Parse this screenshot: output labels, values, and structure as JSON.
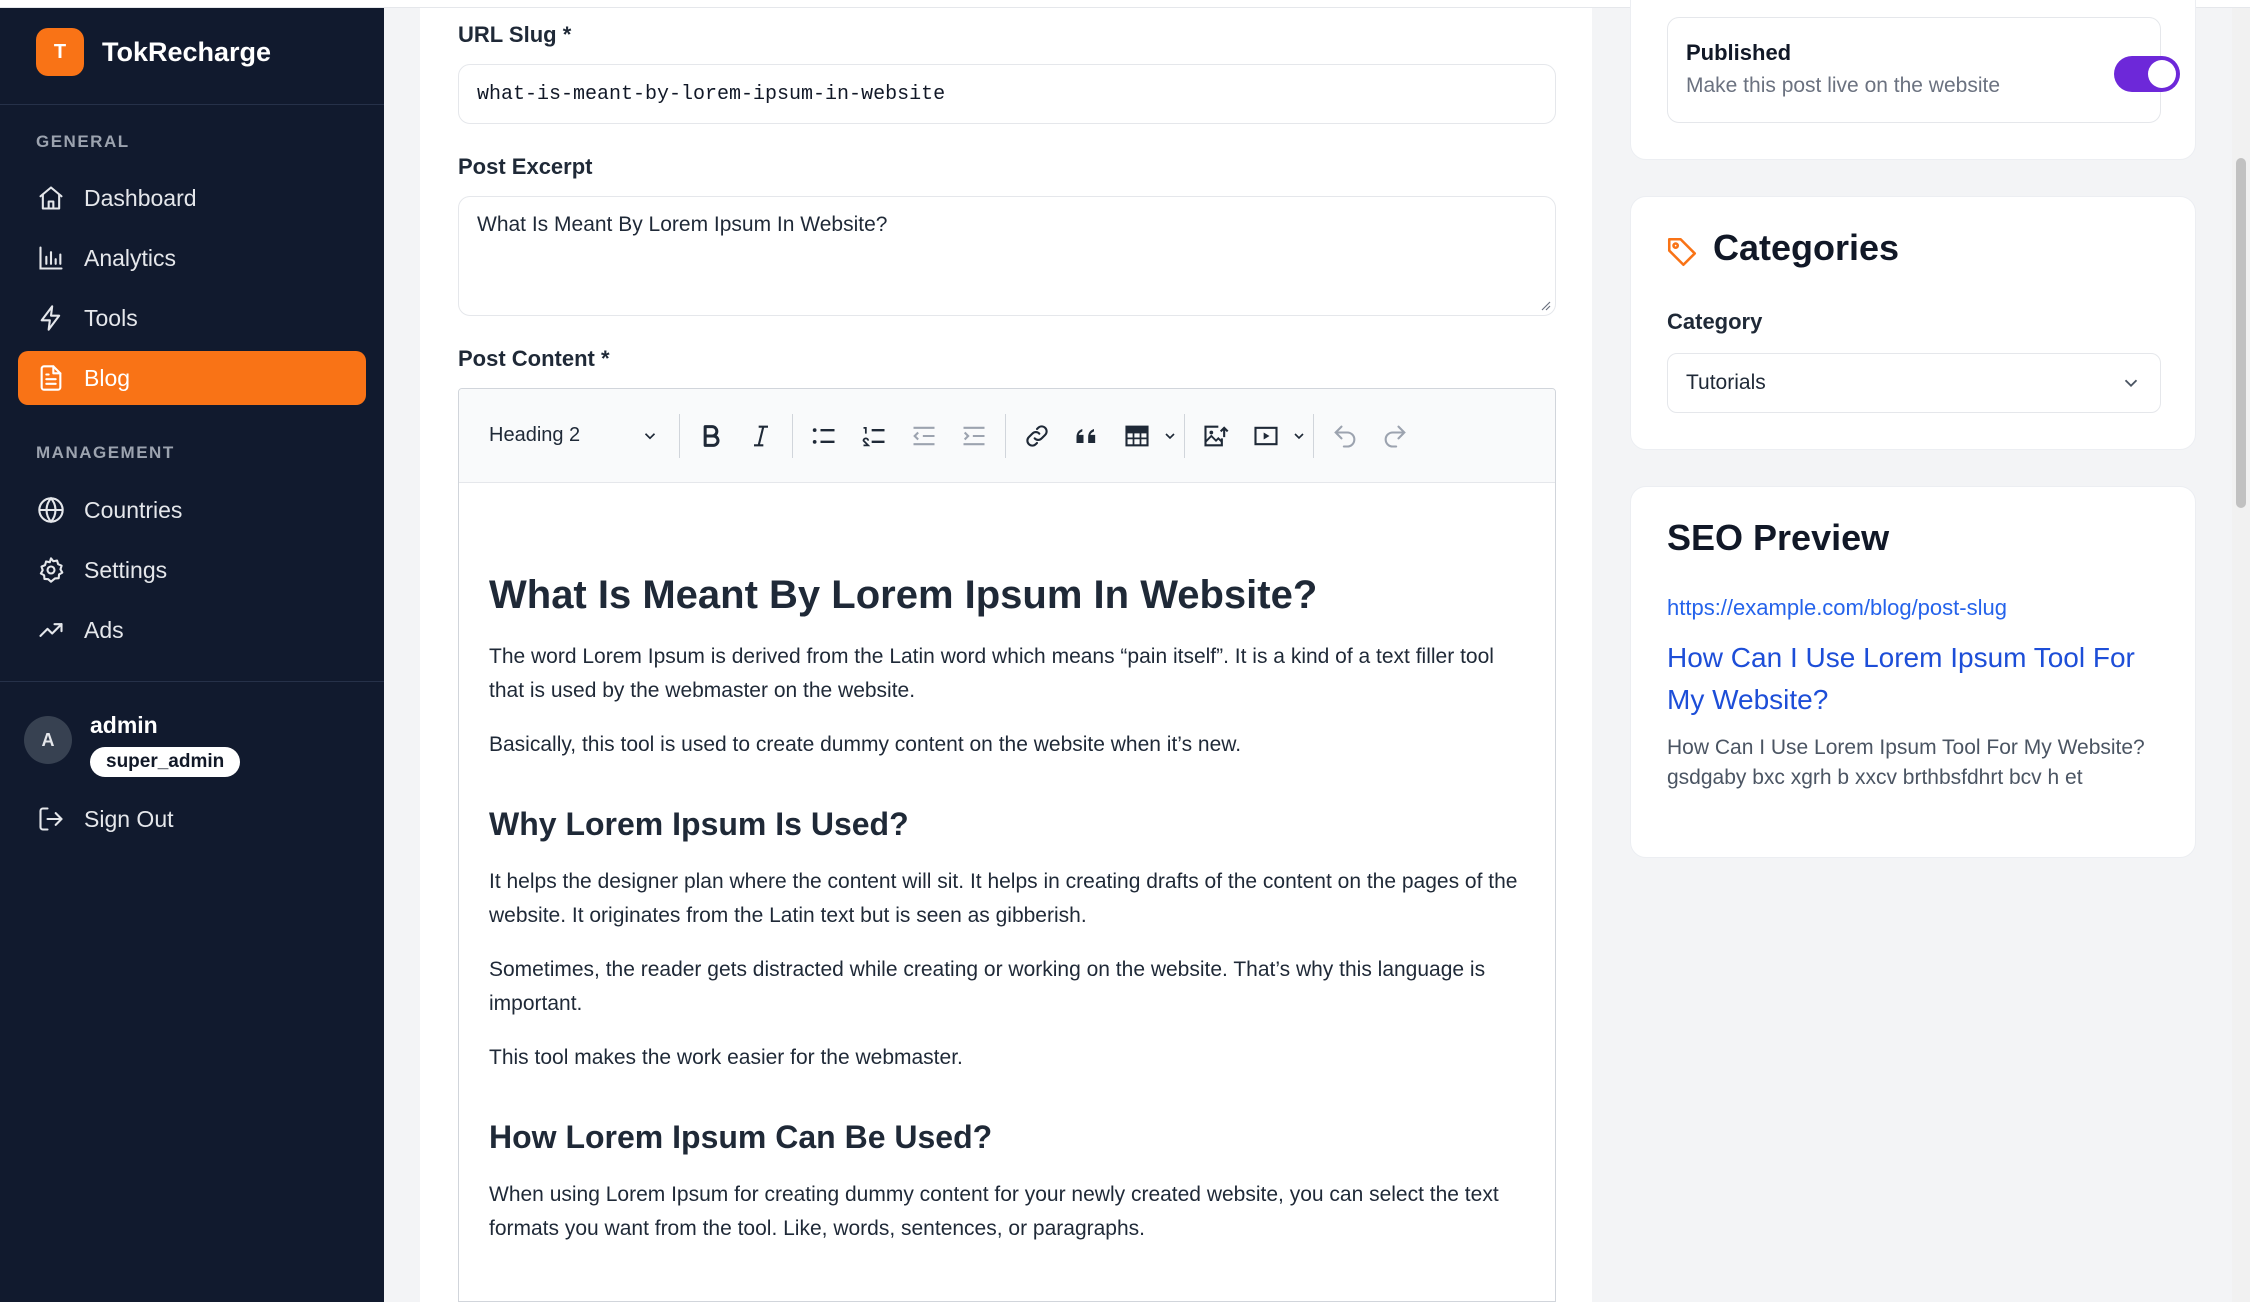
{
  "brand": {
    "logo_letter": "T",
    "name": "TokRecharge"
  },
  "sidebar": {
    "general_label": "GENERAL",
    "management_label": "MANAGEMENT",
    "items": [
      {
        "label": "Dashboard",
        "icon": "home-icon"
      },
      {
        "label": "Analytics",
        "icon": "bar-chart-icon"
      },
      {
        "label": "Tools",
        "icon": "bolt-icon"
      },
      {
        "label": "Blog",
        "icon": "document-icon",
        "active": true
      },
      {
        "label": "Countries",
        "icon": "globe-icon"
      },
      {
        "label": "Settings",
        "icon": "gear-icon"
      },
      {
        "label": "Ads",
        "icon": "trending-up-icon"
      }
    ],
    "user": {
      "avatar_letter": "A",
      "name": "admin",
      "role": "super_admin"
    },
    "sign_out": "Sign Out"
  },
  "form": {
    "slug_label": "URL Slug *",
    "slug_value": "what-is-meant-by-lorem-ipsum-in-website",
    "excerpt_label": "Post Excerpt",
    "excerpt_value": "What Is Meant By Lorem Ipsum In Website?",
    "content_label": "Post Content *"
  },
  "editor": {
    "heading_select": "Heading 2",
    "content": {
      "h1": "What Is Meant By Lorem Ipsum In Website?",
      "p1": "The word Lorem Ipsum is derived from the Latin word which means “pain itself”. It is a kind of a text filler tool that is used by the webmaster on the website.",
      "p2": "Basically, this tool is used to create dummy content on the website when it’s new.",
      "h2": "Why Lorem Ipsum Is Used?",
      "p3": "It helps the designer plan where the content will sit. It helps in creating drafts of the content on the pages of the website. It originates from the Latin text but is seen as gibberish.",
      "p4": "Sometimes, the reader gets distracted while creating or working on the website. That’s why this language is important.",
      "p5": "This tool makes the work easier for the webmaster.",
      "h3": "How Lorem Ipsum Can Be Used?",
      "p6": "When using Lorem Ipsum for creating dummy content for your newly created website, you can select the text formats you want from the tool. Like, words, sentences, or paragraphs."
    }
  },
  "publish": {
    "title": "Published",
    "subtitle": "Make this post live on the website",
    "enabled": true
  },
  "categories": {
    "title": "Categories",
    "label": "Category",
    "selected": "Tutorials"
  },
  "seo": {
    "title": "SEO Preview",
    "url": "https://example.com/blog/post-slug",
    "page_title": "How Can I Use Lorem Ipsum Tool For My Website?",
    "description": "How Can I Use Lorem Ipsum Tool For My Website?gsdgaby bxc xgrh b xxcv brthbsfdhrt bcv h et"
  },
  "colors": {
    "accent": "#f97316",
    "sidebar_bg": "#111a2e",
    "toggle": "#6d28d9",
    "link": "#2563eb"
  }
}
